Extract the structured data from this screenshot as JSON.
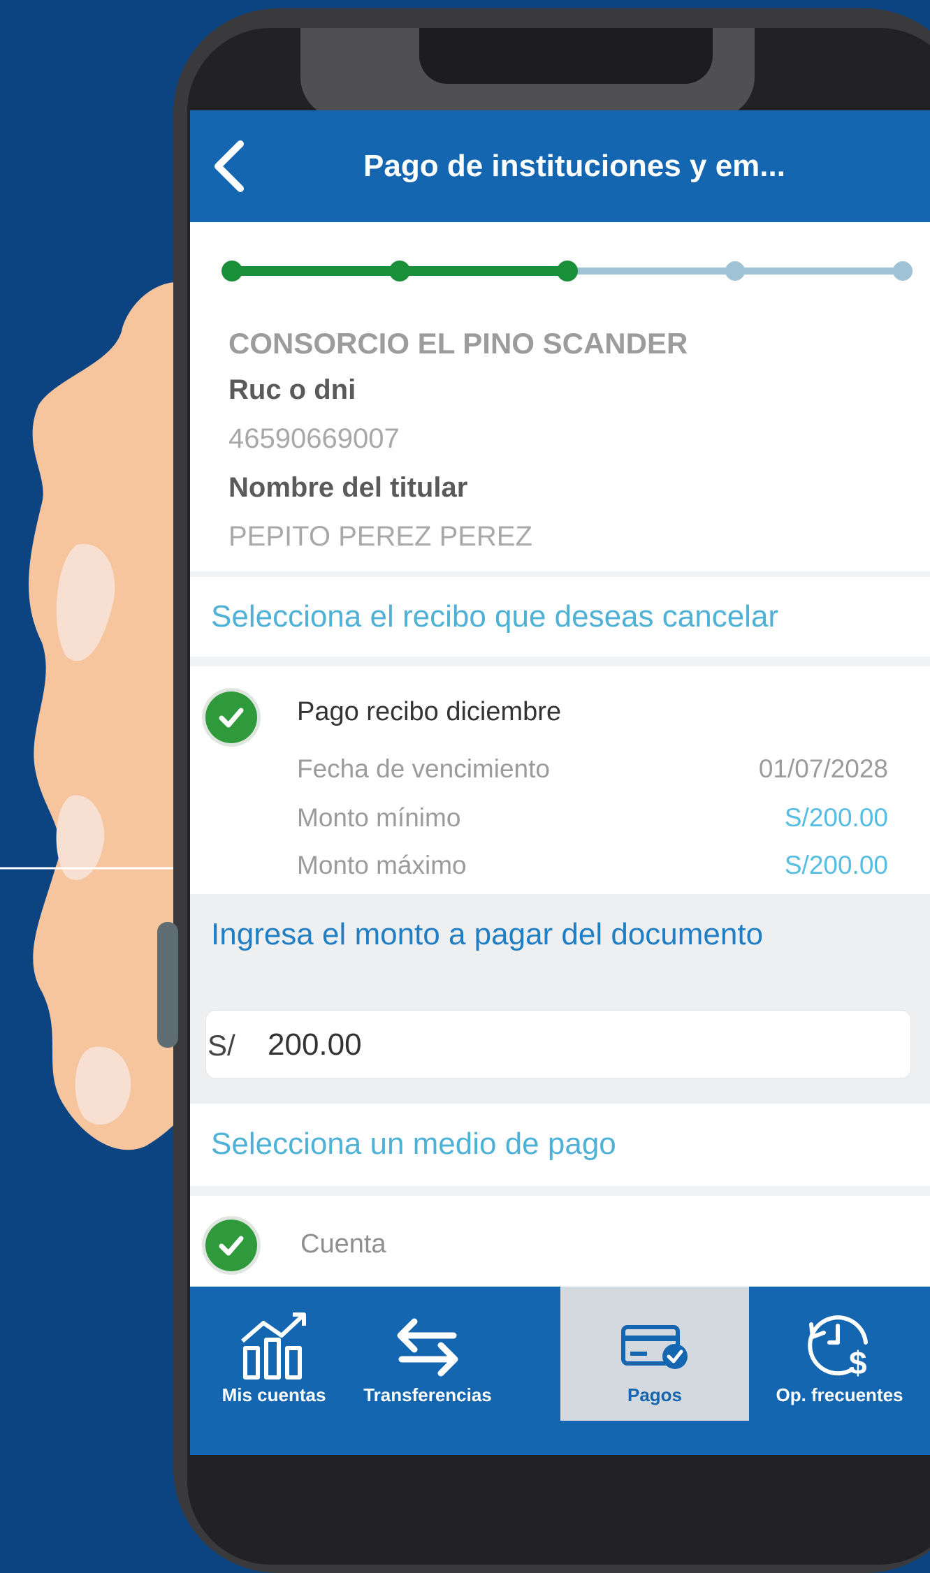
{
  "colors": {
    "background": "#0c4482",
    "header": "#1466b0",
    "progress_done": "#1a8f3a",
    "progress_pending": "#9fc3d6",
    "section_title": "#4fb1d6",
    "amount": "#55bde2",
    "check": "#2f9a3c"
  },
  "header": {
    "back_icon": "chevron-left-icon",
    "title": "Pago de instituciones y em..."
  },
  "progress": {
    "total_steps": 5,
    "completed_steps": 3
  },
  "company": {
    "name": "CONSORCIO EL PINO SCANDER",
    "ruc_label": "Ruc o dni",
    "ruc_value": "46590669007",
    "holder_label": "Nombre del titular",
    "holder_value": "PEPITO PEREZ PEREZ"
  },
  "receipt_section": {
    "title": "Selecciona el recibo que deseas cancelar",
    "receipt": {
      "name": "Pago recibo diciembre",
      "selected": true,
      "due_label": "Fecha de vencimiento",
      "due_value": "01/07/2028",
      "min_label": "Monto mínimo",
      "min_value": "S/200.00",
      "max_label": "Monto máximo",
      "max_value": "S/200.00"
    }
  },
  "amount_section": {
    "title": "Ingresa el monto a pagar del documento",
    "currency": "S/",
    "value": "200.00"
  },
  "payment_section": {
    "title": "Selecciona un medio de pago",
    "option": {
      "label": "Cuenta",
      "selected": true
    }
  },
  "nav": {
    "items": [
      {
        "label": "Mis cuentas",
        "icon": "accounts-chart-icon",
        "active": false
      },
      {
        "label": "Transferencias",
        "icon": "transfer-arrows-icon",
        "active": false
      },
      {
        "label": "Pagos",
        "icon": "card-check-icon",
        "active": true
      },
      {
        "label": "Op. frecuentes",
        "icon": "clock-dollar-icon",
        "active": false
      }
    ]
  }
}
